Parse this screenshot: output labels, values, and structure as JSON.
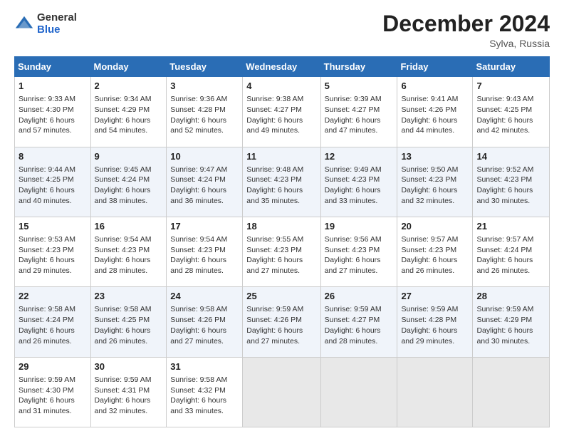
{
  "header": {
    "logo_general": "General",
    "logo_blue": "Blue",
    "month_title": "December 2024",
    "location": "Sylva, Russia"
  },
  "days_of_week": [
    "Sunday",
    "Monday",
    "Tuesday",
    "Wednesday",
    "Thursday",
    "Friday",
    "Saturday"
  ],
  "weeks": [
    [
      {
        "day": "1",
        "sunrise": "9:33 AM",
        "sunset": "4:30 PM",
        "daylight": "6 hours and 57 minutes."
      },
      {
        "day": "2",
        "sunrise": "9:34 AM",
        "sunset": "4:29 PM",
        "daylight": "6 hours and 54 minutes."
      },
      {
        "day": "3",
        "sunrise": "9:36 AM",
        "sunset": "4:28 PM",
        "daylight": "6 hours and 52 minutes."
      },
      {
        "day": "4",
        "sunrise": "9:38 AM",
        "sunset": "4:27 PM",
        "daylight": "6 hours and 49 minutes."
      },
      {
        "day": "5",
        "sunrise": "9:39 AM",
        "sunset": "4:27 PM",
        "daylight": "6 hours and 47 minutes."
      },
      {
        "day": "6",
        "sunrise": "9:41 AM",
        "sunset": "4:26 PM",
        "daylight": "6 hours and 44 minutes."
      },
      {
        "day": "7",
        "sunrise": "9:43 AM",
        "sunset": "4:25 PM",
        "daylight": "6 hours and 42 minutes."
      }
    ],
    [
      {
        "day": "8",
        "sunrise": "9:44 AM",
        "sunset": "4:25 PM",
        "daylight": "6 hours and 40 minutes."
      },
      {
        "day": "9",
        "sunrise": "9:45 AM",
        "sunset": "4:24 PM",
        "daylight": "6 hours and 38 minutes."
      },
      {
        "day": "10",
        "sunrise": "9:47 AM",
        "sunset": "4:24 PM",
        "daylight": "6 hours and 36 minutes."
      },
      {
        "day": "11",
        "sunrise": "9:48 AM",
        "sunset": "4:23 PM",
        "daylight": "6 hours and 35 minutes."
      },
      {
        "day": "12",
        "sunrise": "9:49 AM",
        "sunset": "4:23 PM",
        "daylight": "6 hours and 33 minutes."
      },
      {
        "day": "13",
        "sunrise": "9:50 AM",
        "sunset": "4:23 PM",
        "daylight": "6 hours and 32 minutes."
      },
      {
        "day": "14",
        "sunrise": "9:52 AM",
        "sunset": "4:23 PM",
        "daylight": "6 hours and 30 minutes."
      }
    ],
    [
      {
        "day": "15",
        "sunrise": "9:53 AM",
        "sunset": "4:23 PM",
        "daylight": "6 hours and 29 minutes."
      },
      {
        "day": "16",
        "sunrise": "9:54 AM",
        "sunset": "4:23 PM",
        "daylight": "6 hours and 28 minutes."
      },
      {
        "day": "17",
        "sunrise": "9:54 AM",
        "sunset": "4:23 PM",
        "daylight": "6 hours and 28 minutes."
      },
      {
        "day": "18",
        "sunrise": "9:55 AM",
        "sunset": "4:23 PM",
        "daylight": "6 hours and 27 minutes."
      },
      {
        "day": "19",
        "sunrise": "9:56 AM",
        "sunset": "4:23 PM",
        "daylight": "6 hours and 27 minutes."
      },
      {
        "day": "20",
        "sunrise": "9:57 AM",
        "sunset": "4:23 PM",
        "daylight": "6 hours and 26 minutes."
      },
      {
        "day": "21",
        "sunrise": "9:57 AM",
        "sunset": "4:24 PM",
        "daylight": "6 hours and 26 minutes."
      }
    ],
    [
      {
        "day": "22",
        "sunrise": "9:58 AM",
        "sunset": "4:24 PM",
        "daylight": "6 hours and 26 minutes."
      },
      {
        "day": "23",
        "sunrise": "9:58 AM",
        "sunset": "4:25 PM",
        "daylight": "6 hours and 26 minutes."
      },
      {
        "day": "24",
        "sunrise": "9:58 AM",
        "sunset": "4:26 PM",
        "daylight": "6 hours and 27 minutes."
      },
      {
        "day": "25",
        "sunrise": "9:59 AM",
        "sunset": "4:26 PM",
        "daylight": "6 hours and 27 minutes."
      },
      {
        "day": "26",
        "sunrise": "9:59 AM",
        "sunset": "4:27 PM",
        "daylight": "6 hours and 28 minutes."
      },
      {
        "day": "27",
        "sunrise": "9:59 AM",
        "sunset": "4:28 PM",
        "daylight": "6 hours and 29 minutes."
      },
      {
        "day": "28",
        "sunrise": "9:59 AM",
        "sunset": "4:29 PM",
        "daylight": "6 hours and 30 minutes."
      }
    ],
    [
      {
        "day": "29",
        "sunrise": "9:59 AM",
        "sunset": "4:30 PM",
        "daylight": "6 hours and 31 minutes."
      },
      {
        "day": "30",
        "sunrise": "9:59 AM",
        "sunset": "4:31 PM",
        "daylight": "6 hours and 32 minutes."
      },
      {
        "day": "31",
        "sunrise": "9:58 AM",
        "sunset": "4:32 PM",
        "daylight": "6 hours and 33 minutes."
      },
      null,
      null,
      null,
      null
    ]
  ],
  "labels": {
    "sunrise": "Sunrise:",
    "sunset": "Sunset:",
    "daylight": "Daylight:"
  }
}
